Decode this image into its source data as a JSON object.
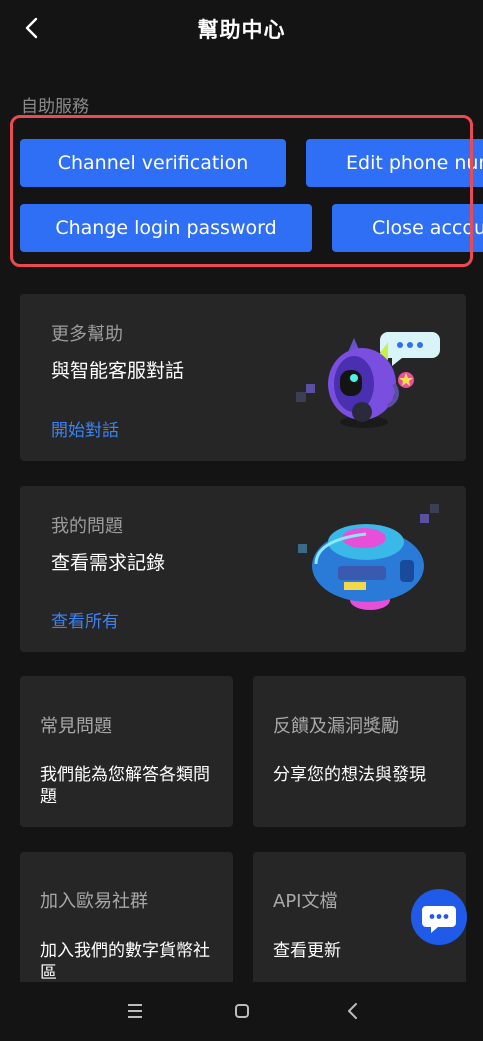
{
  "header": {
    "title": "幫助中心"
  },
  "self_service": {
    "label": "自助服務",
    "row1": [
      "Channel verification",
      "Edit phone number"
    ],
    "row2": [
      "Change login password",
      "Close account"
    ]
  },
  "more_help": {
    "subtitle": "更多幫助",
    "title": "與智能客服對話",
    "link": "開始對話"
  },
  "my_issues": {
    "subtitle": "我的問題",
    "title": "查看需求記錄",
    "link": "查看所有"
  },
  "faq": {
    "title": "常見問題",
    "desc": "我們能為您解答各類問題"
  },
  "feedback": {
    "title": "反饋及漏洞獎勵",
    "desc": "分享您的想法與發現"
  },
  "community": {
    "title": "加入歐易社群",
    "desc": "加入我們的數字貨幣社區"
  },
  "api_docs": {
    "title": "API文檔",
    "desc": "查看更新"
  },
  "colors": {
    "accent": "#2f6ff5",
    "link": "#3a83f5",
    "highlight": "#ec4a52",
    "card": "#262626",
    "background": "#141414"
  },
  "icons": [
    "back-arrow-icon",
    "chat-bubble-icon",
    "menu-icon",
    "home-square-icon",
    "nav-back-icon"
  ]
}
